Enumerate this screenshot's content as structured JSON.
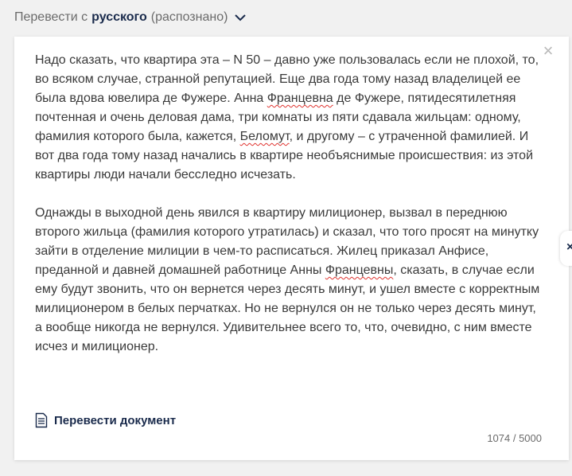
{
  "source_lang": {
    "prefix": "Перевести с",
    "language": "русского",
    "detected": "(распознано)"
  },
  "close_icon": "close-icon",
  "text": {
    "p1": {
      "a": "Надо сказать, что квартира эта – N 50 – давно уже пользовалась если не плохой, то, во всяком случае, странной репутацией. Еще два года тому назад владелицей ее была вдова ювелира де Фужере. Анна ",
      "b": "Францевна",
      "c": " де Фужере, пятидесятилетняя почтенная и очень деловая дама, три комнаты из пяти сдавала жильцам: одному, фамилия которого была, кажется, ",
      "d": "Беломут",
      "e": ", и другому – с утраченной фамилией. И вот два года тому назад начались в квартире необъяснимые происшествия: из этой квартиры люди начали бесследно исчезать."
    },
    "p2": {
      "a": "Однажды в выходной день явился в квартиру милиционер, вызвал в переднюю второго жильца (фамилия которого утратилась) и сказал, что того просят на минутку зайти в отделение милиции в чем-то расписаться. Жилец приказал Анфисе, преданной и давней домашней работнице Анны ",
      "b": "Францевны",
      "c": ", сказать, в случае если ему будут звонить, что он вернется через десять минут, и ушел вместе с корректным милиционером в белых перчатках. Но не вернулся он не только через десять минут, а вообще никогда не вернулся. Удивительнее всего то, что, очевидно, с ним вместе исчез и милиционер."
    }
  },
  "translate_document_label": "Перевести документ",
  "char_counter": "1074 / 5000",
  "side_tab_symbol": "×"
}
